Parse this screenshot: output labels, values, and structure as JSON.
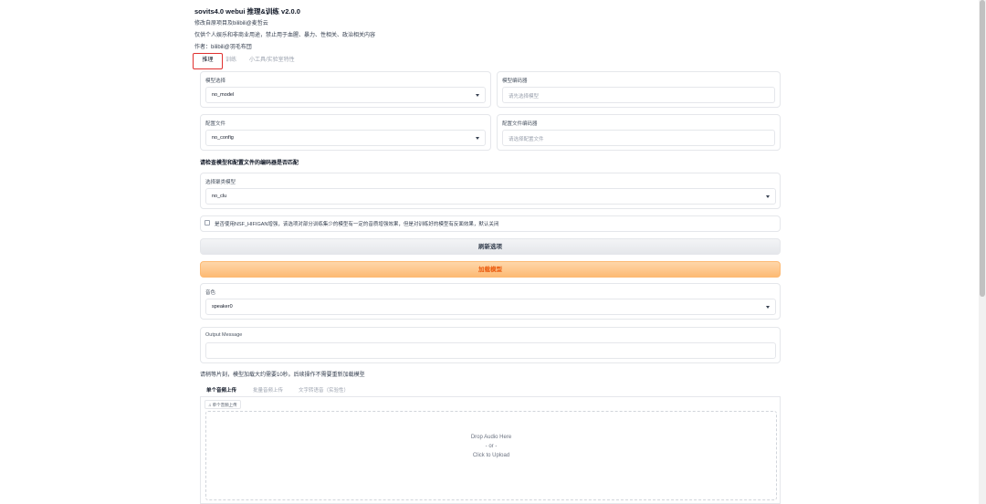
{
  "header": {
    "title": "sovits4.0 webui 推理&训练 v2.0.0",
    "lines": [
      "修改自原项目及bilibili@麦哲云",
      "仅供个人娱乐和非商业用途，禁止用于血腥、暴力、性相关、政治相关内容",
      "作者：bilibili@羽毛布団"
    ]
  },
  "tabs": [
    "推理",
    "训练",
    "小工具/实验室特性"
  ],
  "model": {
    "label": "模型选择",
    "value": "no_model",
    "encoder_label": "模型编码器",
    "encoder_placeholder": "请先选择模型"
  },
  "config": {
    "label": "配置文件",
    "value": "no_config",
    "encoder_label": "配置文件编码器",
    "encoder_placeholder": "请选择配置文件"
  },
  "warning": "请检查模型和配置文件的编码器是否匹配",
  "cluster": {
    "label": "选择聚类模型",
    "value": "no_clu"
  },
  "nsf_checkbox": "是否使用NSF_HIFIGAN增强，该选项对部分训练集少的模型有一定的音质增强效果，但是对训练好的模型有反面效果，默认关闭",
  "buttons": {
    "refresh": "刷新选项",
    "load": "加载模型"
  },
  "speaker": {
    "label": "音色",
    "value": "speaker0"
  },
  "output": {
    "label": "Output Message"
  },
  "load_note": "请稍等片刻，模型加载大约需要10秒。后续操作不需要重新加载模型",
  "sub_tabs": [
    "单个音频上传",
    "批量音频上传",
    "文字转语音（实验性）"
  ],
  "upload": {
    "badge": "单个音频上传",
    "drop": "Drop Audio Here",
    "or": "- or -",
    "click": "Click to Upload"
  },
  "colors": {
    "accent": "#ea580c",
    "highlight_border": "#e0302f"
  }
}
